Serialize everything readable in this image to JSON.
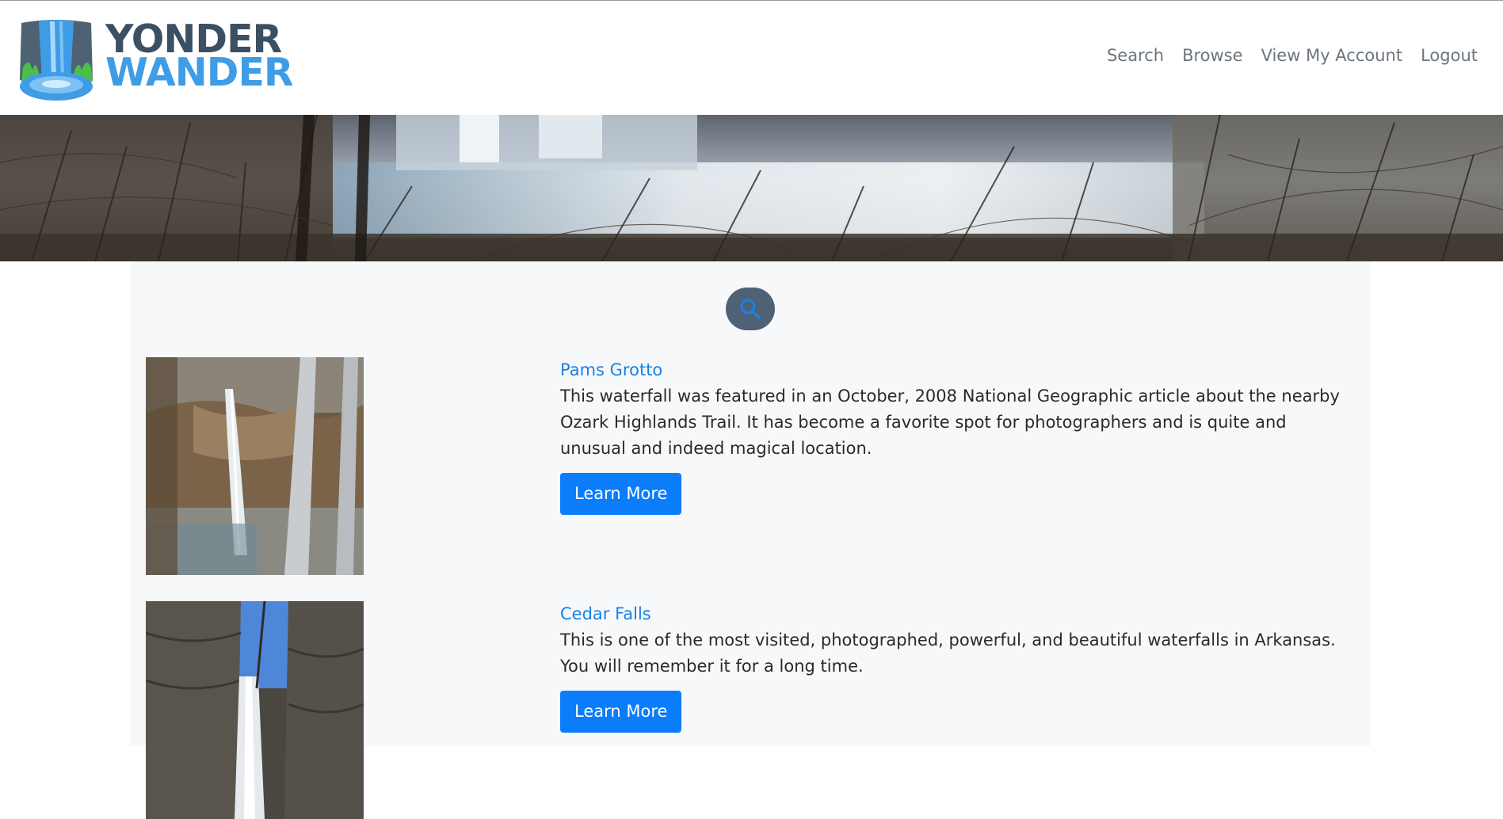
{
  "brand": {
    "line1": "YONDER",
    "line2": "WANDER",
    "logo_icon": "waterfall-logo-icon"
  },
  "nav": {
    "items": [
      "Search",
      "Browse",
      "View My Account",
      "Logout"
    ]
  },
  "search_toggle": {
    "icon": "search-icon"
  },
  "waterfalls": [
    {
      "title": "Pams Grotto",
      "description": "This waterfall was featured in an October, 2008 National Geographic article about the nearby Ozark Highlands Trail. It has become a favorite spot for photographers and is quite and unusual and indeed magical location.",
      "button": "Learn More"
    },
    {
      "title": "Cedar Falls",
      "description": "This is one of the most visited, photographed, powerful, and beautiful waterfalls in Arkansas. You will remember it for a long time.",
      "button": "Learn More"
    }
  ],
  "colors": {
    "brand_dark": "#3c5063",
    "brand_blue": "#3e9de6",
    "link": "#1a80e6",
    "button": "#0b7dfb",
    "panel": "#f7f8fa",
    "nav_text": "#6c757d"
  }
}
